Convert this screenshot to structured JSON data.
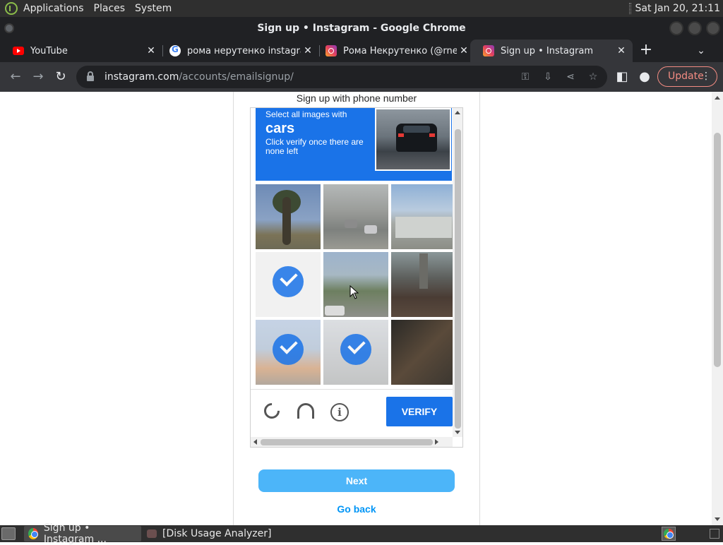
{
  "system_panel": {
    "menus": [
      "Applications",
      "Places",
      "System"
    ],
    "clock": "Sat Jan 20, 21:11"
  },
  "window": {
    "title": "Sign up • Instagram - Google Chrome"
  },
  "tabs": [
    {
      "label": "YouTube",
      "icon": "youtube-icon"
    },
    {
      "label": "рома нерутенко instagram",
      "icon": "google-icon"
    },
    {
      "label": "Рома Некрутенко (@rnekr",
      "icon": "instagram-icon"
    },
    {
      "label": "Sign up • Instagram",
      "icon": "instagram-icon",
      "active": true
    }
  ],
  "toolbar": {
    "url_host": "instagram.com",
    "url_path": "/accounts/emailsignup/",
    "update_label": "Update"
  },
  "page": {
    "heading": "Sign up with phone number",
    "next_label": "Next",
    "go_back_label": "Go back"
  },
  "captcha": {
    "instruction_small": "Select all images with",
    "target": "cars",
    "note": "Click verify once there are none left",
    "verify_label": "VERIFY",
    "tiles_selected": [
      false,
      false,
      false,
      true,
      false,
      false,
      true,
      true,
      false
    ]
  },
  "taskbar": {
    "items": [
      {
        "label": "Sign up • Instagram ...",
        "icon": "chrome-icon",
        "active": true
      },
      {
        "label": "[Disk Usage Analyzer]",
        "icon": "disk-usage-icon",
        "active": false
      }
    ]
  },
  "colors": {
    "captcha_blue": "#1a73e8",
    "next_button": "#4cb5f9",
    "link_blue": "#0095f6",
    "update_red": "#f28b82"
  }
}
